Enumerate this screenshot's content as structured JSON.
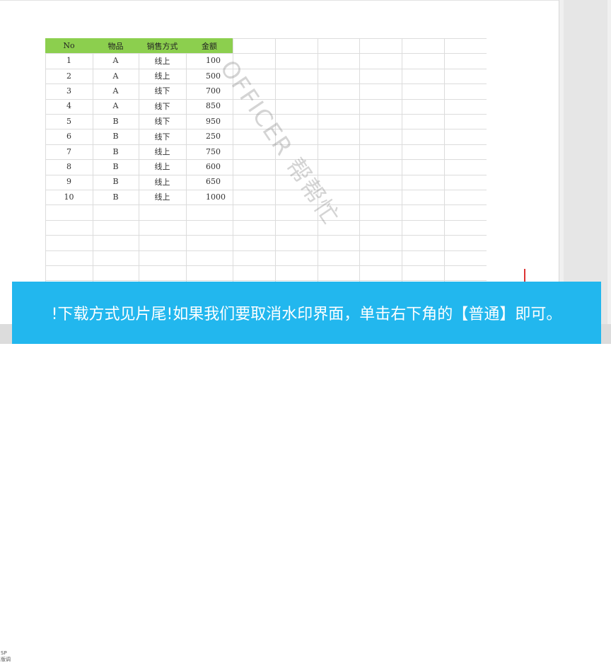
{
  "table": {
    "headers": [
      "No",
      "物品",
      "销售方式",
      "金额"
    ],
    "rows": [
      [
        "1",
        "A",
        "线上",
        "100"
      ],
      [
        "2",
        "A",
        "线上",
        "500"
      ],
      [
        "3",
        "A",
        "线下",
        "700"
      ],
      [
        "4",
        "A",
        "线下",
        "850"
      ],
      [
        "5",
        "B",
        "线下",
        "950"
      ],
      [
        "6",
        "B",
        "线下",
        "250"
      ],
      [
        "7",
        "B",
        "线上",
        "750"
      ],
      [
        "8",
        "B",
        "线上",
        "600"
      ],
      [
        "9",
        "B",
        "线上",
        "650"
      ],
      [
        "10",
        "B",
        "线上",
        "1000"
      ]
    ],
    "header_color": "#8ccf4e"
  },
  "watermark": {
    "text": "OFFICER 帮帮忙"
  },
  "subtitle": {
    "text": "!下载方式见片尾!如果我们要取消水印界面，单击右下角的【普通】即可。",
    "background": "#22b7ee"
  },
  "status": {
    "left_fragment": "SP\n版调"
  }
}
